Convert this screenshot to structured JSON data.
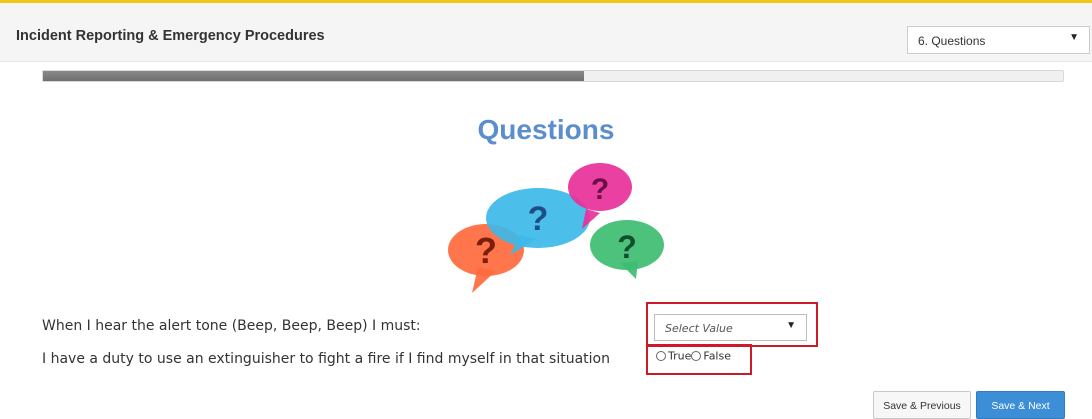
{
  "header": {
    "course_title": "Incident Reporting & Emergency Procedures",
    "section_selector": {
      "selected": "6. Questions"
    }
  },
  "progress": {
    "fraction": 0.53
  },
  "main": {
    "title": "Questions",
    "illustration": {
      "icon": "question-speech-bubbles-icon",
      "bubble_colors": [
        "#ff6a3d",
        "#3db8e8",
        "#e8309a",
        "#3ebd72"
      ],
      "mark": "?"
    },
    "questions": [
      {
        "text": "When I hear the alert tone (Beep, Beep, Beep) I must:",
        "input": {
          "type": "select",
          "value": "Select Value"
        }
      },
      {
        "text": "I have a duty to use an extinguisher to fight a fire if I find myself in that situation",
        "input": {
          "type": "radio",
          "options": [
            "True",
            "False"
          ]
        }
      }
    ]
  },
  "buttons": {
    "previous": "Save & Previous",
    "next": "Save & Next"
  },
  "colors": {
    "accent_top": "#f5c518",
    "title": "#5b8ecf",
    "highlight": "#cc1a2b",
    "primary_button": "#3c8fd6"
  }
}
